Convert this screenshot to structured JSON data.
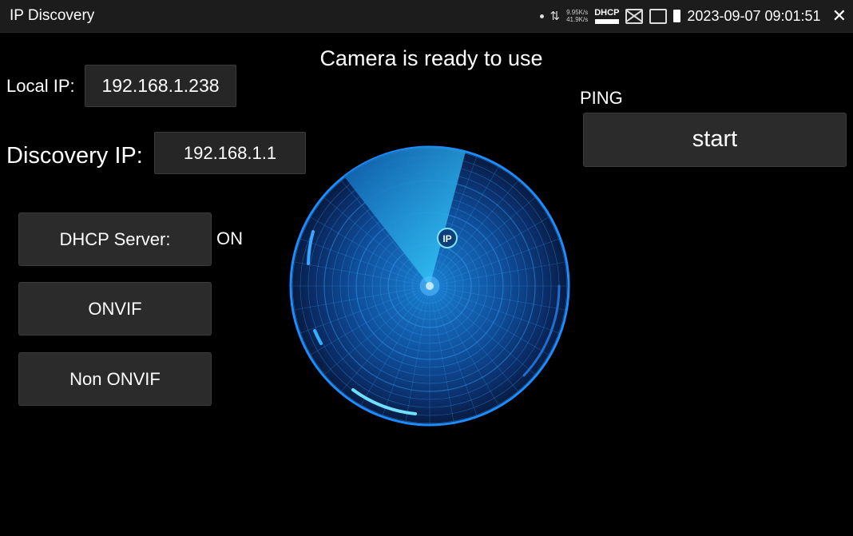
{
  "app": {
    "title": "IP Discovery"
  },
  "statusbar": {
    "speed_up": "9.95K/s",
    "speed_down": "41.9K/s",
    "dhcp_label": "DHCP",
    "datetime": "2023-09-07 09:01:51",
    "close_glyph": "✕",
    "arrows_glyph": "⇅",
    "icons": [
      "dot-icon",
      "network-arrows-icon",
      "dhcp-icon",
      "no-monitor-icon",
      "device-status-icon",
      "battery-icon",
      "close-icon"
    ]
  },
  "main": {
    "status_message": "Camera is ready to use",
    "local_ip_label": "Local IP:",
    "local_ip_value": "192.168.1.238",
    "discovery_ip_label": "Discovery IP:",
    "discovery_ip_value": "192.168.1.1",
    "dhcp_server_label": "DHCP Server:",
    "dhcp_server_state": "ON",
    "onvif_label": "ONVIF",
    "non_onvif_label": "Non ONVIF",
    "ping_label": "PING",
    "start_label": "start",
    "radar_marker": "IP"
  },
  "colors": {
    "background": "#000000",
    "panel": "#2b2b2b",
    "radar_accent": "#29b6f6",
    "radar_dark": "#0b1c3a"
  }
}
